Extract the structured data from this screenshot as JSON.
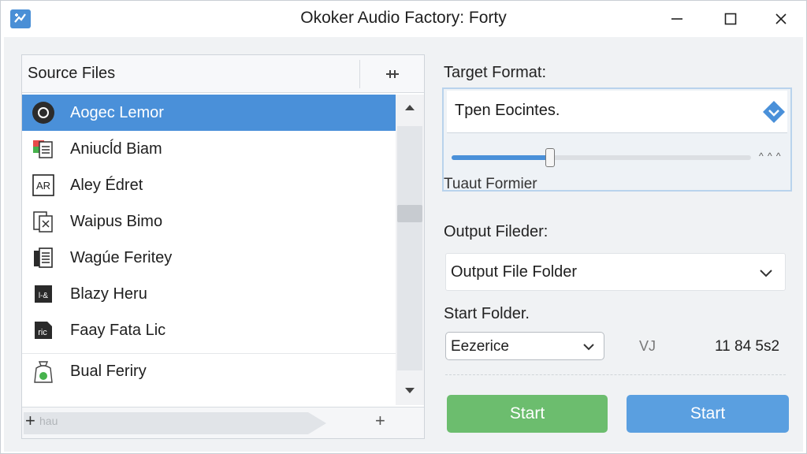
{
  "window": {
    "title": "Okoker Audio Factory: Forty"
  },
  "source": {
    "header": "Source Files",
    "header_button": "+|+",
    "files": [
      {
        "name": "Aogec Lemor",
        "icon": "record-icon",
        "selected": true
      },
      {
        "name": "Aniucĺd Biam",
        "icon": "colored-doc-icon",
        "selected": false
      },
      {
        "name": "Aley Édret",
        "icon": "ar-doc-icon",
        "selected": false
      },
      {
        "name": "Waipus Bimo",
        "icon": "doc-x-icon",
        "selected": false
      },
      {
        "name": "Wagúe Feritey",
        "icon": "dark-doc-icon",
        "selected": false
      },
      {
        "name": "Blazy Heru",
        "icon": "film-icon",
        "selected": false
      },
      {
        "name": "Faay Fata Lic",
        "icon": "dark-file-icon",
        "selected": false
      },
      {
        "name": "Bual Feriry",
        "icon": "bag-icon",
        "selected": false
      }
    ],
    "footer_left_text": "hau",
    "add_symbol": "+"
  },
  "target": {
    "label": "Target Format:",
    "format_value": "Tpen Eocintes.",
    "slider_value": 0.33,
    "slider_marks": "^ ^ ^",
    "caption": "Tuaut Formier"
  },
  "output": {
    "label": "Output Fileder:",
    "value": "Output File Folder"
  },
  "start": {
    "label": "Start Folder.",
    "select_value": "Eezerice",
    "unit": "VJ",
    "value": "11 84 5s2"
  },
  "buttons": {
    "start_green": "Start",
    "start_blue": "Start"
  },
  "colors": {
    "accent": "#4a90d9",
    "green": "#6cbd6e",
    "blue": "#5a9fe0"
  }
}
